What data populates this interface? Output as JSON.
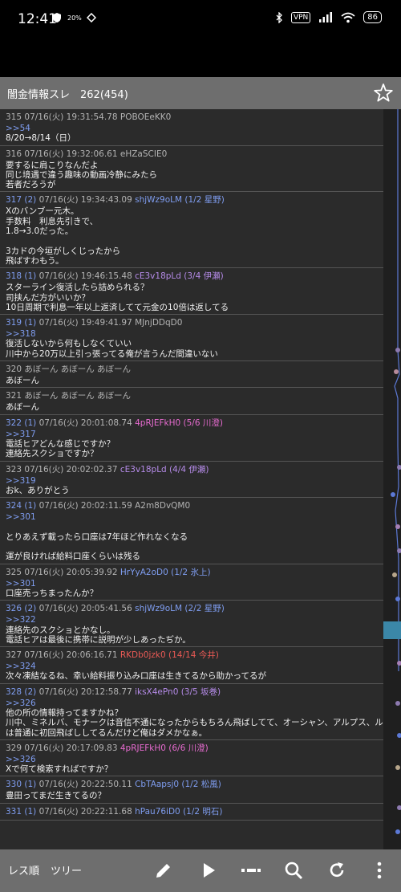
{
  "status_bar": {
    "time": "12:41",
    "vpn": "VPN",
    "battery": "86",
    "small_badge": "20%"
  },
  "header": {
    "title": "闇金情報スレ　262(454)"
  },
  "posts": [
    {
      "head": [
        {
          "t": "315",
          "c": "num"
        },
        {
          "t": "  07/16(火) 19:31:54.78 ",
          "c": "pid-plain"
        },
        {
          "t": "POBOEeKK0",
          "c": "pid-plain"
        }
      ],
      "lines": [
        {
          "t": ">>54",
          "a": true
        },
        {
          "t": "8/20→8/14（日）"
        }
      ]
    },
    {
      "head": [
        {
          "t": "316",
          "c": "num"
        },
        {
          "t": "  07/16(火) 19:32:06.61 ",
          "c": "pid-plain"
        },
        {
          "t": "eHZaSCIE0",
          "c": "pid-plain"
        }
      ],
      "lines": [
        {
          "t": "要するに肩こりなんだよ"
        },
        {
          "t": "同じ境遇で違う趣味の動画冷静にみたら"
        },
        {
          "t": "若者だろうが"
        }
      ]
    },
    {
      "head": [
        {
          "t": "317 (2)",
          "c": "num linked"
        },
        {
          "t": "  07/16(火) 19:34:43.09 ",
          "c": "pid-plain"
        },
        {
          "t": "shjWz9oLM (1/2 星野)",
          "c": "pid-blue"
        }
      ],
      "lines": [
        {
          "t": "Xのバンブー元木。"
        },
        {
          "t": "手数料　利息先引きで、"
        },
        {
          "t": "1.8→3.0だった。"
        },
        {
          "t": ""
        },
        {
          "t": "3カドの今垣がしくじったから"
        },
        {
          "t": "飛ばすわもう。"
        }
      ]
    },
    {
      "head": [
        {
          "t": "318 (1)",
          "c": "num linked"
        },
        {
          "t": "  07/16(火) 19:46:15.48 ",
          "c": "pid-plain"
        },
        {
          "t": "cE3v18pLd (3/4 伊瀬)",
          "c": "pid-purple"
        }
      ],
      "lines": [
        {
          "t": "スターライン復活したら詰められる？"
        },
        {
          "t": "司挟んだ方がいいか？"
        },
        {
          "t": "10日周期で利息一年以上返済してて元金の10倍は返してる"
        }
      ]
    },
    {
      "head": [
        {
          "t": "319 (1)",
          "c": "num linked"
        },
        {
          "t": "  07/16(火) 19:49:41.97 ",
          "c": "pid-plain"
        },
        {
          "t": "MJnjDDqD0",
          "c": "pid-plain"
        }
      ],
      "lines": [
        {
          "t": ">>318",
          "a": true
        },
        {
          "t": "復活しないから何もしなくていい"
        },
        {
          "t": "川中から20万以上引っ張ってる俺が言うんだ間違いない"
        }
      ]
    },
    {
      "head": [
        {
          "t": "320",
          "c": "num"
        },
        {
          "t": "  あぼーん あぼーん あぼーん",
          "c": "pid-plain"
        }
      ],
      "lines": [
        {
          "t": "あぼーん"
        }
      ]
    },
    {
      "head": [
        {
          "t": "321",
          "c": "num"
        },
        {
          "t": "  あぼーん あぼーん あぼーん",
          "c": "pid-plain"
        }
      ],
      "lines": [
        {
          "t": "あぼーん"
        }
      ]
    },
    {
      "head": [
        {
          "t": "322 (1)",
          "c": "num linked"
        },
        {
          "t": "  07/16(火) 20:01:08.74 ",
          "c": "pid-plain"
        },
        {
          "t": "4pRJEFkH0 (5/6 川澄)",
          "c": "pid-pink"
        }
      ],
      "lines": [
        {
          "t": ">>317",
          "a": true
        },
        {
          "t": "電話ヒアどんな感じですか？"
        },
        {
          "t": "連絡先スクショですか？"
        }
      ]
    },
    {
      "head": [
        {
          "t": "323",
          "c": "num"
        },
        {
          "t": "  07/16(火) 20:02:02.37 ",
          "c": "pid-plain"
        },
        {
          "t": "cE3v18pLd (4/4 伊瀬)",
          "c": "pid-purple"
        }
      ],
      "lines": [
        {
          "t": ">>319",
          "a": true
        },
        {
          "t": "おk、ありがとう"
        }
      ]
    },
    {
      "head": [
        {
          "t": "324 (1)",
          "c": "num linked"
        },
        {
          "t": "  07/16(火) 20:02:11.59 ",
          "c": "pid-plain"
        },
        {
          "t": "A2m8DvQM0",
          "c": "pid-plain"
        }
      ],
      "lines": [
        {
          "t": ">>301",
          "a": true
        },
        {
          "t": ""
        },
        {
          "t": "とりあえず載ったら口座は7年ほど作れなくなる"
        },
        {
          "t": ""
        },
        {
          "t": "運が良ければ給料口座くらいは残る"
        }
      ]
    },
    {
      "head": [
        {
          "t": "325",
          "c": "num"
        },
        {
          "t": "  07/16(火) 20:05:39.92 ",
          "c": "pid-plain"
        },
        {
          "t": "HrYyA2oD0 (1/2 氷上)",
          "c": "pid-blue"
        }
      ],
      "lines": [
        {
          "t": ">>301",
          "a": true
        },
        {
          "t": "口座売っちまったんか？"
        }
      ]
    },
    {
      "head": [
        {
          "t": "326 (2)",
          "c": "num linked"
        },
        {
          "t": "  07/16(火) 20:05:41.56 ",
          "c": "pid-plain"
        },
        {
          "t": "shjWz9oLM (2/2 星野)",
          "c": "pid-blue"
        }
      ],
      "lines": [
        {
          "t": ">>322",
          "a": true
        },
        {
          "t": "連絡先のスクショとかなし。"
        },
        {
          "t": "電話ヒアは最後に携帯に説明が少しあったぢか。"
        }
      ]
    },
    {
      "head": [
        {
          "t": "327",
          "c": "num"
        },
        {
          "t": "  07/16(火) 20:06:16.71 ",
          "c": "pid-plain"
        },
        {
          "t": "RKDb0jzk0 (14/14 今井)",
          "c": "pid-red"
        }
      ],
      "lines": [
        {
          "t": ">>324",
          "a": true
        },
        {
          "t": "次々凍結なるね、幸い給料振り込み口座は生きてるから助かってるが"
        }
      ]
    },
    {
      "head": [
        {
          "t": "328 (2)",
          "c": "num linked"
        },
        {
          "t": "  07/16(火) 20:12:58.77 ",
          "c": "pid-plain"
        },
        {
          "t": "iksX4ePn0 (3/5 坂巻)",
          "c": "pid-purple"
        }
      ],
      "lines": [
        {
          "t": ">>326",
          "a": true
        },
        {
          "t": "他の所の情報持ってますかね？"
        },
        {
          "t": "川中、ミネルバ、モナークは音信不通になったからもちろん飛ばしてて、オーシャン、アルプス、ループ"
        },
        {
          "t": "は普通に初回飛ばししてるんだけど俺はダメかなぁ。"
        }
      ]
    },
    {
      "head": [
        {
          "t": "329",
          "c": "num"
        },
        {
          "t": "  07/16(火) 20:17:09.83 ",
          "c": "pid-plain"
        },
        {
          "t": "4pRJEFkH0 (6/6 川澄)",
          "c": "pid-pink"
        }
      ],
      "lines": [
        {
          "t": ">>326",
          "a": true
        },
        {
          "t": "Xで何て検索すればですか？"
        }
      ]
    },
    {
      "head": [
        {
          "t": "330 (1)",
          "c": "num linked"
        },
        {
          "t": "  07/16(火) 20:22:50.11 ",
          "c": "pid-plain"
        },
        {
          "t": "CbTAapsj0 (1/2 松風)",
          "c": "pid-blue"
        }
      ],
      "lines": [
        {
          "t": "豊田ってまだ生きてるの？"
        }
      ]
    },
    {
      "head": [
        {
          "t": "331 (1)",
          "c": "num linked"
        },
        {
          "t": "  07/16(火) 20:22:11.68 ",
          "c": "pid-plain"
        },
        {
          "t": "hPau76iD0 (1/2 明石)",
          "c": "pid-blue"
        }
      ],
      "lines": []
    }
  ],
  "bottom_bar": {
    "tab_active": "レス順",
    "tab_tree": "ツリー"
  },
  "icons": [
    "star-icon",
    "pencil-icon",
    "play-icon",
    "minus-dots-icon",
    "search-icon",
    "refresh-icon",
    "more-vert-icon"
  ],
  "colors": {
    "background": "#2b2b2b",
    "bar": "#6e6e6e",
    "anchor": "#7f9df0",
    "purple": "#b58be8",
    "pink": "#e76bd0",
    "red": "#ea5a55"
  }
}
